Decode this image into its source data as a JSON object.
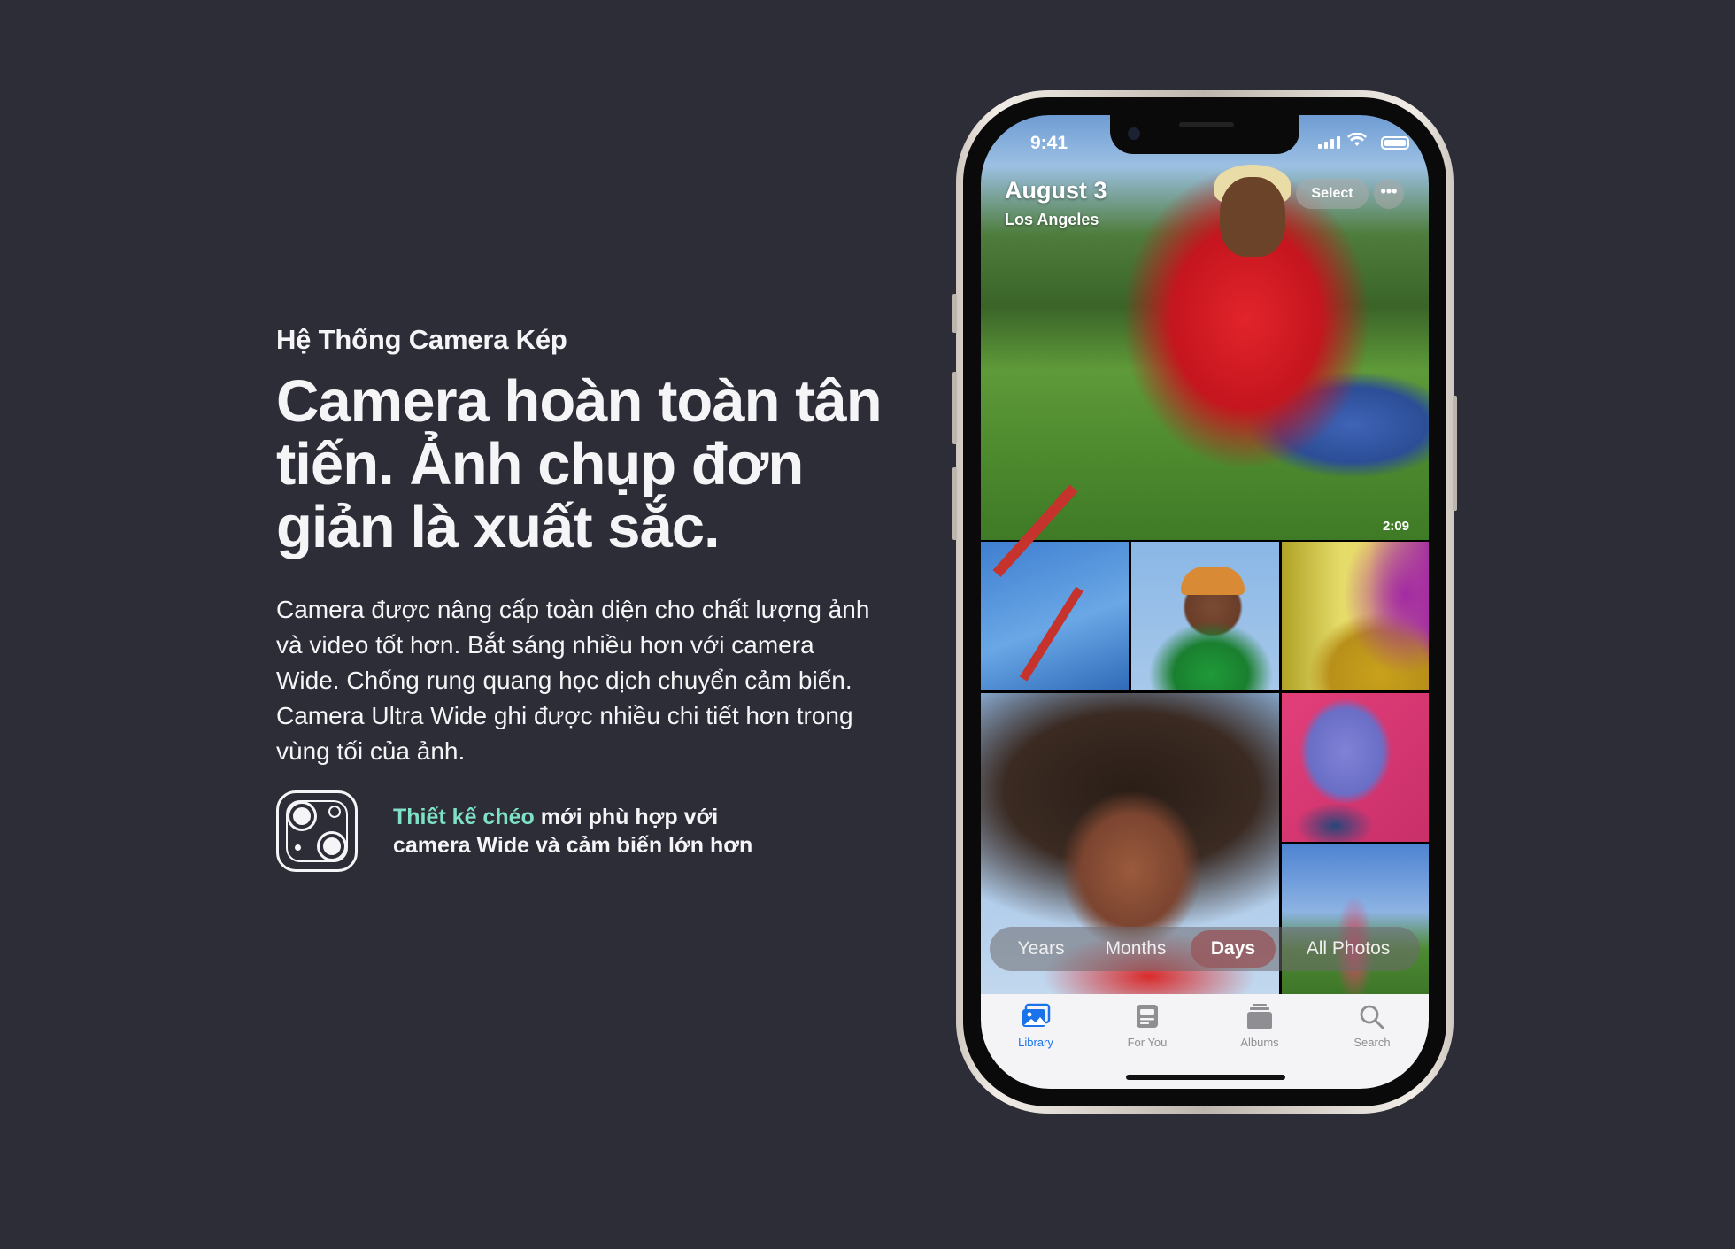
{
  "copy": {
    "eyebrow": "Hệ Thống Camera Kép",
    "headline": "Camera hoàn toàn tân tiến. Ảnh chụp đơn giản là xuất sắc.",
    "body": "Camera được nâng cấp toàn diện cho chất lượng ảnh và video tốt hơn. Bắt sáng nhiều hơn với camera Wide. Chống rung quang học dịch chuyển cảm biến. Camera Ultra Wide ghi được nhiều chi tiết hơn trong vùng tối của ảnh.",
    "feature_highlight": "Thiết kế chéo",
    "feature_rest": " mới phù hợp với camera Wide và cảm biến lớn hơn",
    "feature_icon": "dual-camera-icon"
  },
  "phone": {
    "status": {
      "time": "9:41",
      "icons": [
        "cellular-signal-icon",
        "wifi-icon",
        "battery-icon"
      ]
    },
    "header": {
      "date": "August 3",
      "location": "Los Angeles",
      "select_label": "Select",
      "more_label": "•••"
    },
    "hero_duration": "2:09",
    "segments": [
      "Years",
      "Months",
      "Days",
      "All Photos"
    ],
    "active_segment": "Days",
    "tabs": [
      {
        "label": "Library",
        "icon": "photo-library-icon",
        "active": true
      },
      {
        "label": "For You",
        "icon": "for-you-icon",
        "active": false
      },
      {
        "label": "Albums",
        "icon": "albums-icon",
        "active": false
      },
      {
        "label": "Search",
        "icon": "search-icon",
        "active": false
      }
    ]
  },
  "colors": {
    "background": "#2d2d38",
    "accent_text": "#7ee0c4",
    "active_tab": "#1a73e8"
  }
}
